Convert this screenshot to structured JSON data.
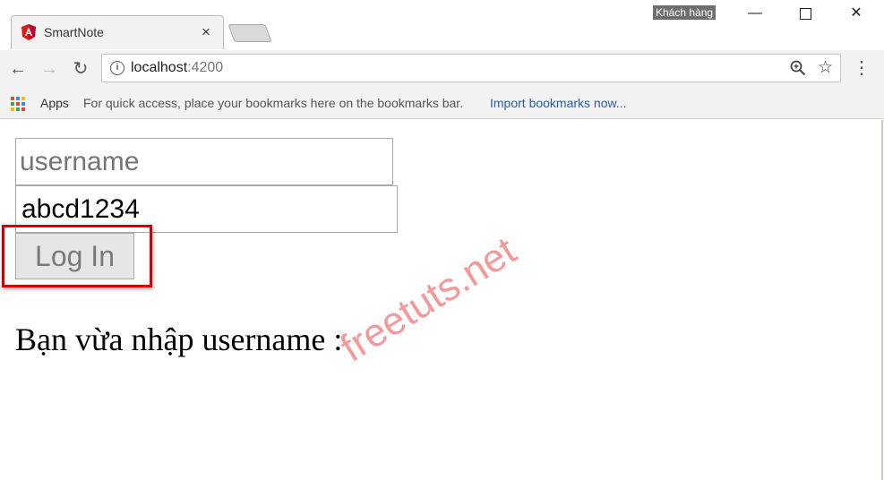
{
  "browser": {
    "tab_title": "SmartNote",
    "tab_close": "×",
    "profile_name": "Khách hàng",
    "url_host": "localhost",
    "url_port": ":4200",
    "apps_label": "Apps",
    "bookmarks_hint": "For quick access, place your bookmarks here on the bookmarks bar.",
    "import_bookmarks": "Import bookmarks now..."
  },
  "form": {
    "username_placeholder": "username",
    "username_value": "",
    "password_value": "abcd1234",
    "login_label": "Log In"
  },
  "result_text": "Bạn vừa nhập username :",
  "watermark": "freetuts.net",
  "colors": {
    "highlight": "#d40000",
    "angular_red": "#dd1b16",
    "link": "#2a5db0"
  }
}
